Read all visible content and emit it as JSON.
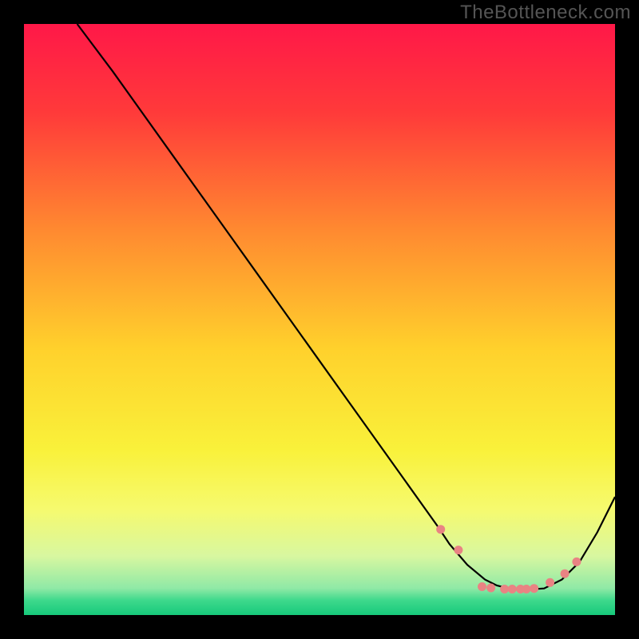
{
  "watermark": "TheBottleneck.com",
  "chart_data": {
    "type": "line",
    "title": "",
    "xlabel": "",
    "ylabel": "",
    "xlim": [
      0,
      100
    ],
    "ylim": [
      0,
      100
    ],
    "curve": {
      "name": "bottleneck-curve",
      "color": "#000000",
      "x": [
        9,
        12,
        15,
        20,
        25,
        30,
        35,
        40,
        45,
        50,
        55,
        60,
        65,
        70,
        72,
        75,
        78,
        80,
        82,
        85,
        88,
        91,
        94,
        97,
        100
      ],
      "y": [
        100,
        96,
        92,
        85,
        78,
        71,
        64,
        57,
        50,
        43,
        36,
        29,
        22,
        15,
        12,
        8.5,
        6,
        5,
        4.5,
        4.3,
        4.5,
        6,
        9,
        14,
        20
      ]
    },
    "markers": {
      "color": "#e98383",
      "radius": 5.5,
      "x": [
        70.5,
        73.5,
        77.5,
        79,
        81.3,
        82.6,
        84,
        85,
        86.3,
        89,
        91.5,
        93.5
      ],
      "y": [
        14.5,
        11,
        4.8,
        4.6,
        4.4,
        4.4,
        4.4,
        4.4,
        4.5,
        5.5,
        7.0,
        9.0
      ]
    },
    "gradient_stops": [
      {
        "offset": 0.0,
        "color": "#ff1848"
      },
      {
        "offset": 0.15,
        "color": "#ff3a3a"
      },
      {
        "offset": 0.35,
        "color": "#ff8a30"
      },
      {
        "offset": 0.55,
        "color": "#ffd12c"
      },
      {
        "offset": 0.72,
        "color": "#f9f13a"
      },
      {
        "offset": 0.82,
        "color": "#f6fa6e"
      },
      {
        "offset": 0.9,
        "color": "#d8f7a0"
      },
      {
        "offset": 0.955,
        "color": "#8fe9a6"
      },
      {
        "offset": 0.975,
        "color": "#3ed98c"
      },
      {
        "offset": 1.0,
        "color": "#17c97b"
      }
    ]
  }
}
